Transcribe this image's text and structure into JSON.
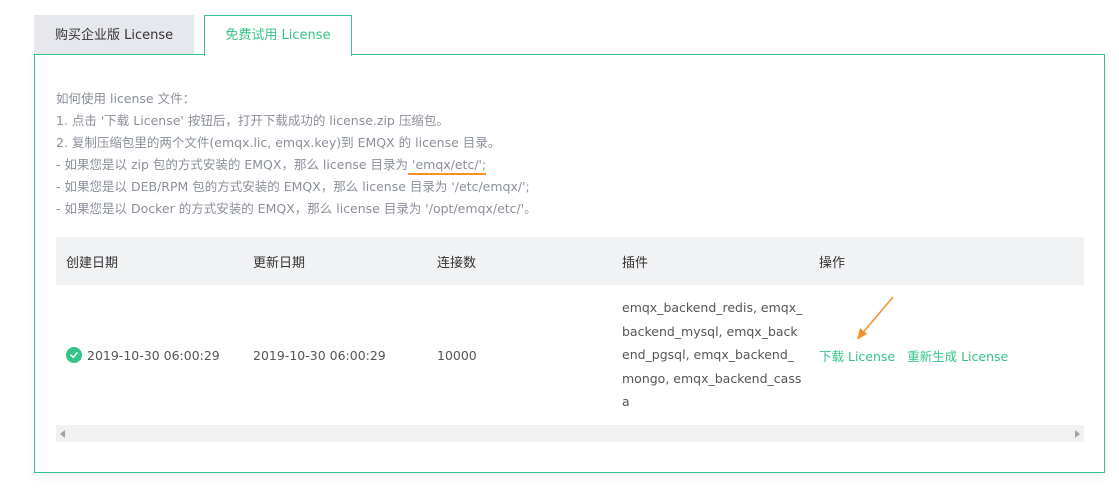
{
  "tabs": [
    {
      "label": "购买企业版 License",
      "active": false
    },
    {
      "label": "免费试用 License",
      "active": true
    }
  ],
  "guide": {
    "title": "如何使用 license 文件：",
    "step1": "1. 点击 '下载 License' 按钮后，打开下载成功的 license.zip 压缩包。",
    "step2": "2. 复制压缩包里的两个文件(emqx.lic, emqx.key)到 EMQX 的 license 目录。",
    "zip_prefix": "- 如果您是以 zip 包的方式安装的 EMQX，那么 license 目录为",
    "zip_path": " 'emqx/etc/';",
    "deb": "- 如果您是以 DEB/RPM 包的方式安装的 EMQX，那么 license 目录为 '/etc/emqx/';",
    "docker": "- 如果您是以 Docker 的方式安装的 EMQX，那么 license 目录为 '/opt/emqx/etc/'。"
  },
  "table": {
    "headers": [
      "创建日期",
      "更新日期",
      "连接数",
      "插件",
      "操作"
    ],
    "rows": [
      {
        "created": "2019-10-30 06:00:29",
        "updated": "2019-10-30 06:00:29",
        "connections": "10000",
        "plugins": "emqx_backend_redis, emqx_backend_mysql, emqx_backend_pgsql, emqx_backend_mongo, emqx_backend_cassa",
        "status_icon": "check-circle-icon",
        "actions": {
          "download": "下载 License",
          "regenerate": "重新生成 License"
        }
      }
    ]
  },
  "colors": {
    "accent": "#34c388",
    "annotation": "#f5912c"
  }
}
